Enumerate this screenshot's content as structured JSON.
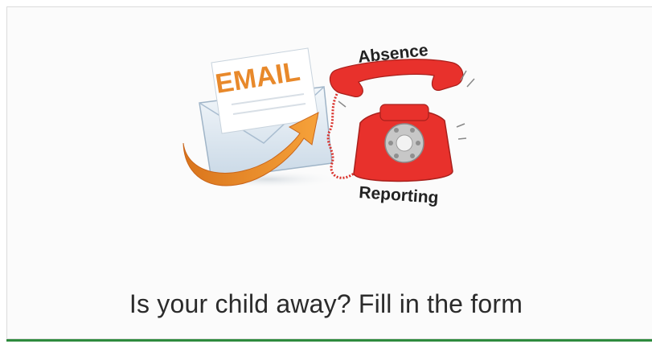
{
  "card": {
    "illustration": {
      "email_label": "EMAIL",
      "absence_label": "Absence",
      "reporting_label": "Reporting",
      "colors": {
        "email_text": "#e8892b",
        "arrow": "#f0962a",
        "phone": "#e8312c",
        "envelope": "#e6eef5"
      }
    },
    "caption": "Is your child away? Fill in the form",
    "accent_color": "#2e8b3e"
  }
}
